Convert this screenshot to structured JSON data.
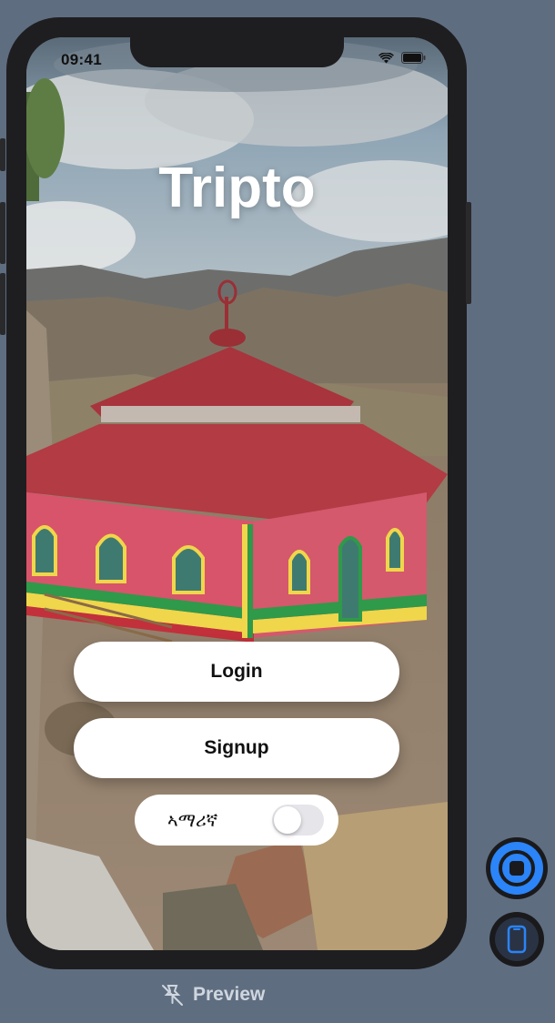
{
  "status_bar": {
    "time": "09:41",
    "icons": [
      "wifi-icon",
      "battery-icon"
    ]
  },
  "app": {
    "title": "Tripto"
  },
  "buttons": {
    "login": "Login",
    "signup": "Signup"
  },
  "language_toggle": {
    "label": "ኣማሪኛ",
    "enabled": false
  },
  "preview": {
    "label": "Preview",
    "icon": "preview-pin-icon"
  },
  "controls": [
    "live-mode-icon",
    "device-icon"
  ],
  "colors": {
    "page_bg": "#5f6d80",
    "accent": "#2b84f8",
    "roof": "#b03a45",
    "wall": "#d9576a"
  }
}
